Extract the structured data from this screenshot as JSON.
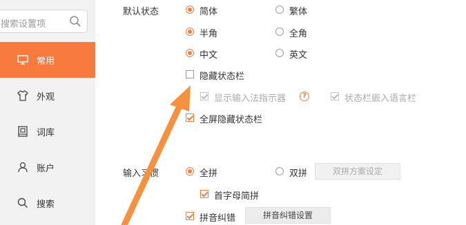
{
  "sidebar": {
    "search_placeholder": "搜索设置项",
    "items": [
      {
        "label": "常用",
        "icon": "monitor-icon",
        "active": true
      },
      {
        "label": "外观",
        "icon": "shirt-icon",
        "active": false
      },
      {
        "label": "词库",
        "icon": "dictionary-icon",
        "active": false
      },
      {
        "label": "账户",
        "icon": "user-icon",
        "active": false
      },
      {
        "label": "搜索",
        "icon": "search-icon",
        "active": false
      }
    ]
  },
  "default_state": {
    "title": "默认状态",
    "simplified": "简体",
    "traditional": "繁体",
    "half_width": "半角",
    "full_width": "全角",
    "chinese": "中文",
    "english": "英文",
    "hide_status_bar": "隐藏状态栏",
    "show_indicator": "显示输入法指示器",
    "embed_language_bar": "状态栏嵌入语言栏",
    "fullscreen_hide": "全屏隐藏状态栏"
  },
  "input_habit": {
    "title": "输入习惯",
    "full_pinyin": "全拼",
    "double_pinyin": "双拼",
    "double_scheme_button": "双拼方案设定",
    "initial_abbrev": "首字母简拼",
    "pinyin_correction": "拼音纠错",
    "correction_settings_button": "拼音纠错设置"
  },
  "colors": {
    "accent": "#f77a3e",
    "sidebar_bg": "#f2f2f2"
  }
}
